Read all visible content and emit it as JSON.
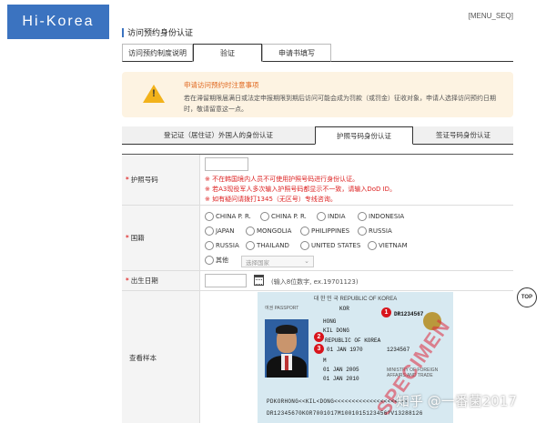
{
  "brand": {
    "logo_text": "Hi-Korea",
    "menu_seq": "[MENU_SEQ]"
  },
  "page_title": "访问预约身份认证",
  "top_tabs": [
    {
      "label": "访问预约制度说明",
      "active": false
    },
    {
      "label": "验证",
      "active": true
    },
    {
      "label": "申请书填写",
      "active": false
    }
  ],
  "notice": {
    "title": "申请访问预约时注意事项",
    "text": "若在滞留期限届满日或法定申报期限到期后访问可能会成为罚款（或罚金）征收对象，申请人选择访问预约日期时，敬请留意这一点。"
  },
  "id_tabs": [
    {
      "label": "登记证（居住证）外国人的身份认证",
      "active": false
    },
    {
      "label": "护照号码身份认证",
      "active": true
    },
    {
      "label": "签证号码身份认证",
      "active": false
    }
  ],
  "form": {
    "passport_label": "护照号码",
    "passport_value": "",
    "errors": [
      "※ 不在韩国境内人员不可使用护照号码进行身份认证。",
      "※ 若A3现役军人多次输入护照号码都显示不一致，请输入DoD ID。",
      "※ 如有疑问请拨打1345（无区号）专线咨询。"
    ],
    "nationality_label": "国籍",
    "nationality_options": [
      [
        "CHINA P. R.",
        "CHINA P. R.",
        "INDIA",
        "INDONESIA"
      ],
      [
        "JAPAN",
        "MONGOLIA",
        "PHILIPPINES",
        "RUSSIA"
      ],
      [
        "RUSSIA",
        "THAILAND",
        "UNITED STATES",
        "VIETNAM"
      ]
    ],
    "other_label": "其他",
    "other_select_placeholder": "选择国家",
    "birth_label": "出生日期",
    "birth_value": "",
    "birth_hint": "(输入8位数字, ex.19701123)",
    "sample_label": "查看样本"
  },
  "passport_sample": {
    "header": "대 한 민 국   REPUBLIC OF KOREA",
    "type_label": "여권 PASSPORT",
    "country": "KOR",
    "passport_no": "DR1234567",
    "surname": "HONG",
    "given_name": "KIL DONG",
    "nationality": "REPUBLIC OF KOREA",
    "birth": "01 JAN 1970",
    "sex": "M",
    "issue": "01 JAN 2005",
    "expiry": "01 JAN 2010",
    "personal_no": "1234567",
    "authority": "MINISTRY OF FOREIGN AFFAIRS AND TRADE",
    "specimen": "SPECIMEN",
    "markers": [
      "1",
      "2",
      "3"
    ],
    "mrz_line1": "PDKORHONG<<KIL<DONG<<<<<<<<<<<<<<<<<<<<<",
    "mrz_line2": "DR12345670KOR7001017M1001015123456?V13288126"
  },
  "watermark": "知乎 @一番菌2017",
  "top_button": "TOP"
}
